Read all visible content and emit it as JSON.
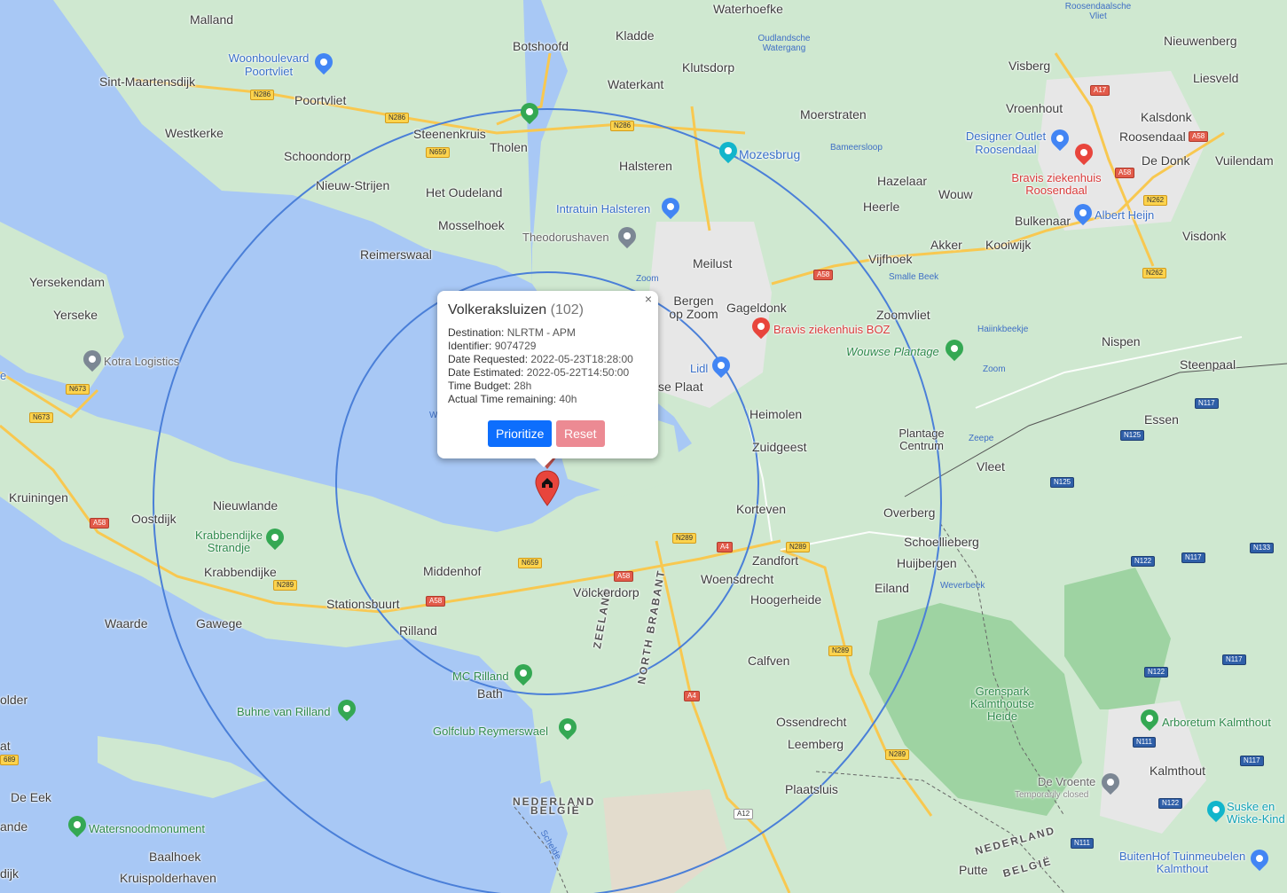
{
  "popup": {
    "title": "Volkeraksluizen",
    "count": "(102)",
    "close_glyph": "×",
    "rows": [
      {
        "label": "Destination:",
        "value": "NLRTM - APM"
      },
      {
        "label": "Identifier:",
        "value": "9074729"
      },
      {
        "label": "Date Requested:",
        "value": "2022-05-23T18:28:00"
      },
      {
        "label": "Date Estimated:",
        "value": "2022-05-22T14:50:00"
      },
      {
        "label": "Time Budget:",
        "value": "28h"
      },
      {
        "label": "Actual Time remaining:",
        "value": "40h"
      }
    ],
    "prioritize_label": "Prioritize",
    "reset_label": "Reset"
  },
  "places": {
    "malland": "Malland",
    "waterhoefke": "Waterhoefke",
    "kladde": "Kladde",
    "botshoofd": "Botshoofd",
    "klutsdorp": "Klutsdorp",
    "waterkant": "Waterkant",
    "moerstraten": "Moerstraten",
    "nieuwenberg": "Nieuwenberg",
    "visberg": "Visberg",
    "liesveld": "Liesveld",
    "vroenhout": "Vroenhout",
    "kalsdonk": "Kalsdonk",
    "roosendaal": "Roosendaal",
    "de_donk": "De Donk",
    "vuilendam": "Vuilendam",
    "sint_maartensdijk": "Sint-Maartensdijk",
    "poortvliet": "Poortvliet",
    "westkerke": "Westkerke",
    "steenenkruis": "Steenenkruis",
    "tholen": "Tholen",
    "schoondorp": "Schoondorp",
    "halsteren": "Halsteren",
    "nieuw_strijen": "Nieuw-Strijen",
    "het_oudeland": "Het Oudeland",
    "hazelaar": "Hazelaar",
    "wouw": "Wouw",
    "heerle": "Heerle",
    "bulkenaar": "Bulkenaar",
    "mosselhoek": "Mosselhoek",
    "reimerswaal": "Reimerswaal",
    "meilust": "Meilust",
    "akker": "Akker",
    "kooiwijk": "Kooiwijk",
    "visdonk": "Visdonk",
    "vijfhoek": "Vijfhoek",
    "yersekendam": "Yersekendam",
    "yerseke": "Yerseke",
    "bergen_op_zoom": "Bergen op Zoom",
    "gageldonk": "Gageldonk",
    "zoomvliet": "Zoomvliet",
    "nispen": "Nispen",
    "steenpaal": "Steenpaal",
    "heimolen": "Heimolen",
    "essen": "Essen",
    "zuidgeest": "Zuidgeest",
    "plantage_centrum": "Plantage Centrum",
    "vleet": "Vleet",
    "kruiningen": "Kruiningen",
    "oostdijk": "Oostdijk",
    "nieuwlande": "Nieuwlande",
    "korteven": "Korteven",
    "overberg": "Overberg",
    "schoellieberg": "Schoellieberg",
    "huijbergen": "Huijbergen",
    "krabbendijke": "Krabbendijke",
    "middenhof": "Middenhof",
    "zandfort": "Zandfort",
    "woensdrecht": "Woensdrecht",
    "eiland": "Eiland",
    "volckerdorp": "Völckerdorp",
    "hoogerheide": "Hoogerheide",
    "stationsbuurt": "Stationsbuurt",
    "waarde": "Waarde",
    "gawege": "Gawege",
    "rilland": "Rilland",
    "calfven": "Calfven",
    "bath": "Bath",
    "ossendrecht": "Ossendrecht",
    "leemberg": "Leemberg",
    "kalmthout": "Kalmthout",
    "plaatsluis": "Plaatsluis",
    "de_eek": "De Eek",
    "baalhoek": "Baalhoek",
    "kruispolderhaven": "Kruispolderhaven",
    "putte": "Putte",
    "older": "older",
    "ande": "ande",
    "dijk": "dijk",
    "at": "at",
    "e": "e",
    "lidl": "Lidl",
    "se_plaat": "se Plaat"
  },
  "pois": {
    "woonboulevard": "Woonboulevard Poortvliet",
    "designer_outlet": "Designer Outlet Roosendaal",
    "mozesbrug": "Mozesbrug",
    "intratuin": "Intratuin Halsteren",
    "theodorushaven": "Theodorushaven",
    "bravis_roosendaal": "Bravis ziekenhuis Roosendaal",
    "albert_heijn": "Albert Heijn",
    "kotra": "Kotra Logistics",
    "bravis_boz": "Bravis ziekenhuis BOZ",
    "wouwse_plantage": "Wouwse Plantage",
    "krabbendijke_strandje": "Krabbendijke Strandje",
    "mc_rilland": "MC Rilland",
    "buhne": "Buhne van Rilland",
    "golfclub": "Golfclub Reymerswael",
    "grenspark": "Grenspark Kalmthoutse Heide",
    "arboretum": "Arboretum Kalmthout",
    "de_vroente": "De Vroente",
    "temporarily_closed": "Temporarily closed",
    "suske": "Suske en Wiske-Kind",
    "buitenhof": "BuitenHof Tuinmeubelen Kalmthout",
    "watersnood": "Watersnoodmonument"
  },
  "water": {
    "oudlandsche": "Oudlandsche Watergang",
    "roosendaalsche": "Roosendaalsche Vliet",
    "bameersloop": "Bameersloop",
    "smalle_beek": "Smalle Beek",
    "haiinkbeekje": "Haiinkbeekje",
    "zoom1": "Zoom",
    "zoom2": "Zoom",
    "zeepe": "Zeepe",
    "weverbeek": "Weverbeek",
    "schelde": "Schelde",
    "w": "W"
  },
  "regions": {
    "nederland_belgie_1a": "NEDERLAND",
    "nederland_belgie_1b": "BELGIË",
    "nederland_belgie_2a": "NEDERLAND",
    "nederland_belgie_2b": "BELGIË",
    "zeeland": "ZEELAND",
    "north_brabant": "NORTH BRABANT"
  },
  "roads": {
    "n286a": "N286",
    "n286b": "N286",
    "n286c": "N286",
    "n659a": "N659",
    "n659b": "N659",
    "a17": "A17",
    "a58a": "A58",
    "a58b": "A58",
    "a58c": "A58",
    "a58d": "A58",
    "a58e": "A58",
    "n262a": "N262",
    "n262b": "N262",
    "n673a": "N673",
    "n673b": "N673",
    "n289a": "N289",
    "n289b": "N289",
    "n289c": "N289",
    "n289d": "N289",
    "n289e": "N289",
    "a4a": "A4",
    "a4b": "A4",
    "n125a": "N125",
    "n125b": "N125",
    "n117a": "N117",
    "n117b": "N117",
    "n117c": "N117",
    "n122a": "N122",
    "n122b": "N122",
    "n122c": "N122",
    "n133": "N133",
    "n111a": "N111",
    "n111b": "N111",
    "a12": "A12",
    "n289f": "689"
  },
  "colors": {
    "land": "#cfe8d0",
    "water": "#a8c8f5",
    "radius_circle": "#4a7fd8",
    "marker": "#e8453c",
    "prioritize": "#0d6efd",
    "reset": "#ec8a93"
  },
  "icons": {
    "marker": "home-map-marker-icon",
    "close": "close-icon"
  }
}
